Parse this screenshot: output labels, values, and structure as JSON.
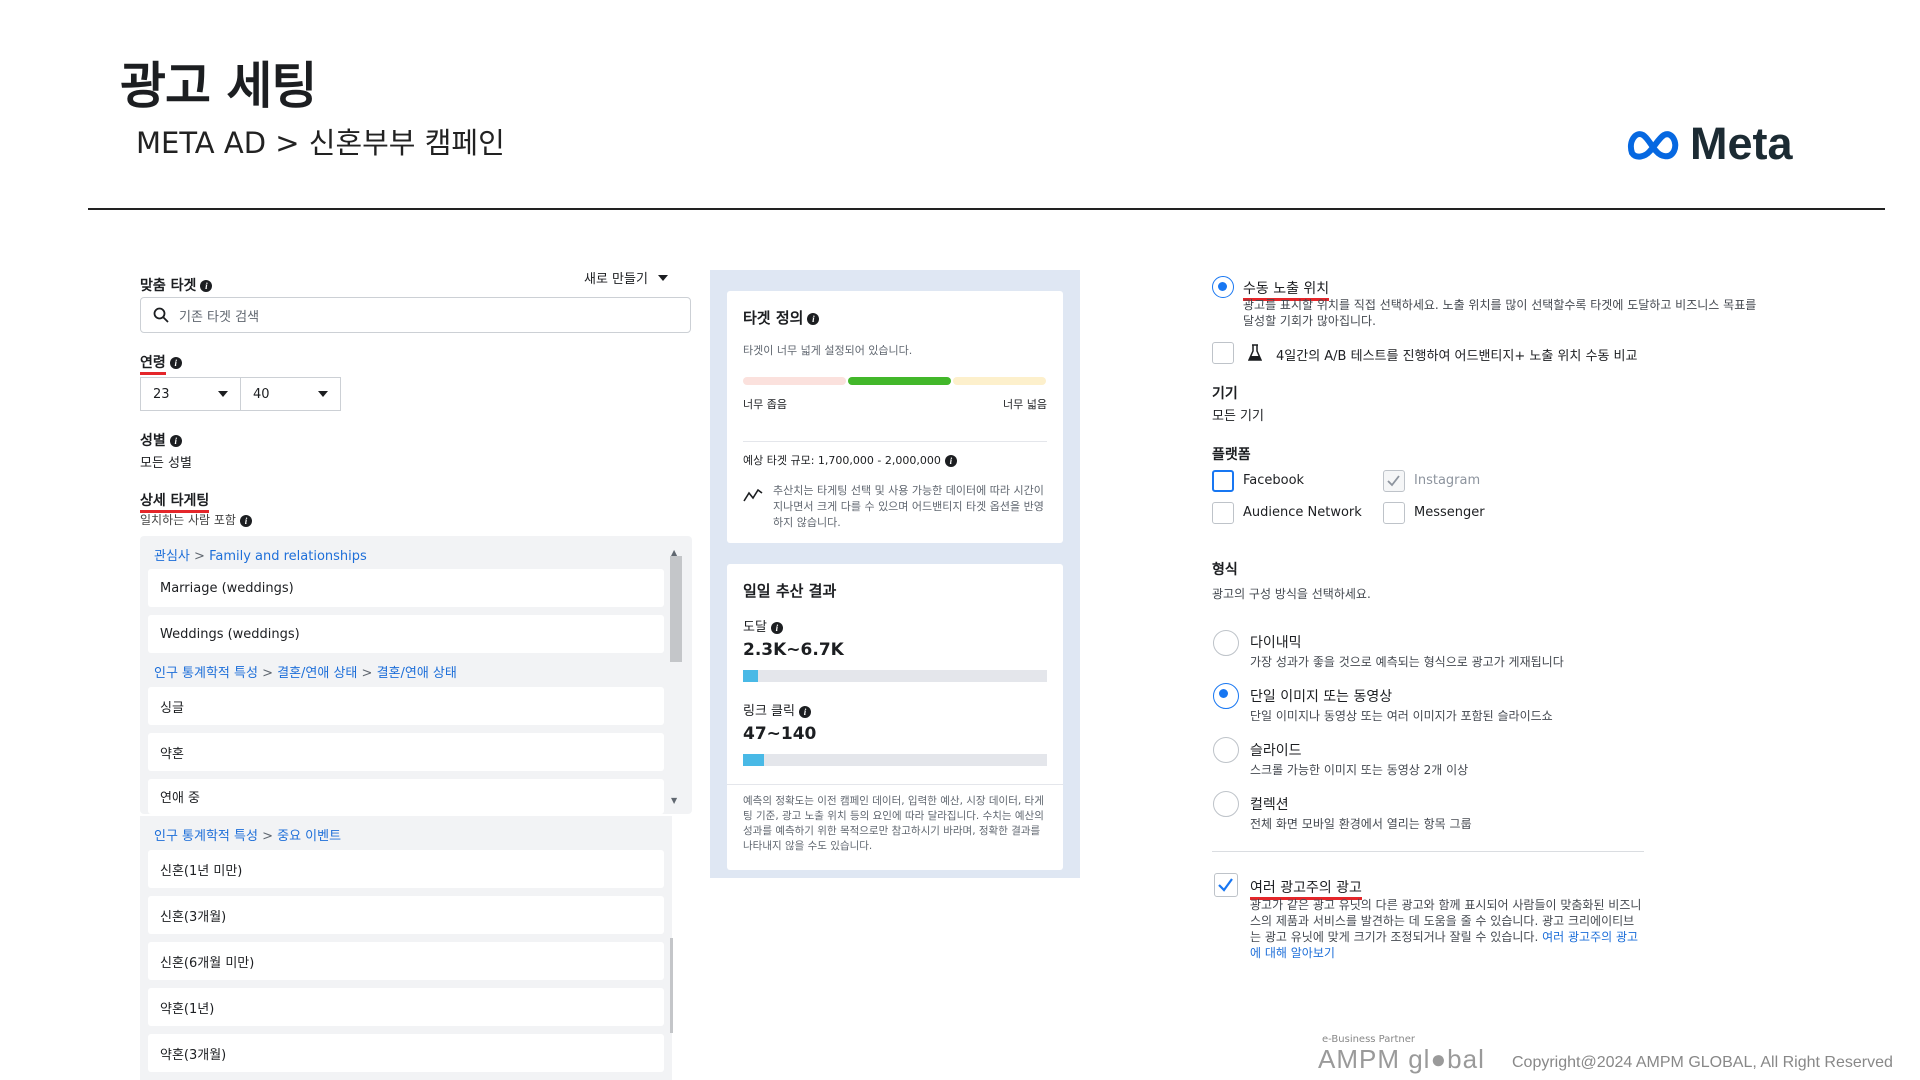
{
  "header": {
    "title": "광고 세팅",
    "subtitle": "META AD > 신혼부부 캠페인",
    "logo_text": "Meta"
  },
  "left": {
    "custom_audience_label": "맞춤 타겟",
    "create_new_label": "새로 만들기",
    "search_placeholder": "기존 타겟 검색",
    "age_label": "연령",
    "age_min": "23",
    "age_max": "40",
    "gender_label": "성별",
    "gender_value": "모든 성별",
    "detailed_label": "상세 타게팅",
    "detailed_sub": "일치하는 사람 포함",
    "group1": {
      "crumb1": "관심사",
      "crumb2": "Family and relationships",
      "items": [
        "Marriage (weddings)",
        "Weddings (weddings)"
      ]
    },
    "group2": {
      "crumb1": "인구 통계학적 특성",
      "crumb2": "결혼/연애 상태",
      "crumb3": "결혼/연애 상태",
      "items": [
        "싱글",
        "약혼",
        "연애 중"
      ]
    },
    "group3": {
      "crumb1": "인구 통계학적 특성",
      "crumb2": "중요 이벤트",
      "items": [
        "신혼(1년 미만)",
        "신혼(3개월)",
        "신혼(6개월 미만)",
        "약혼(1년)",
        "약혼(3개월)"
      ]
    }
  },
  "middle": {
    "def_title": "타겟 정의",
    "def_msg": "타겟이 너무 넓게 설정되어 있습니다.",
    "narrow": "너무 좁음",
    "broad": "너무 넓음",
    "size_label": "예상 타겟 규모: 1,700,000 - 2,000,000",
    "estimate_note": "추산치는 타게팅 선택 및 사용 가능한 데이터에 따라 시간이 지나면서 크게 다를 수 있으며 어드밴티지 타겟 옵션을 반영하지 않습니다.",
    "daily_title": "일일 추산 결과",
    "reach_label": "도달",
    "reach_value": "2.3K~6.7K",
    "reach_fill": 0.05,
    "clicks_label": "링크 클릭",
    "clicks_value": "47~140",
    "clicks_fill": 0.07,
    "accuracy_note": "예측의 정확도는 이전 캠페인 데이터, 입력한 예산, 시장 데이터, 타게팅 기준, 광고 노출 위치 등의 요인에 따라 달라집니다. 수치는 예산의 성과를 예측하기 위한 목적으로만 참고하시기 바라며, 정확한 결과를 나타내지 않을 수도 있습니다."
  },
  "right": {
    "manual_title": "수동 노출 위치",
    "manual_desc": "광고를 표시할 위치를 직접 선택하세요. 노출 위치를 많이 선택할수록 타겟에 도달하고 비즈니스 목표를 달성할 기회가 많아집니다.",
    "ab_test": "4일간의 A/B 테스트를 진행하여 어드밴티지+ 노출 위치 수동 비교",
    "device_label": "기기",
    "device_value": "모든 기기",
    "platform_label": "플랫폼",
    "platforms": [
      "Facebook",
      "Instagram",
      "Audience Network",
      "Messenger"
    ],
    "format_label": "형식",
    "format_desc": "광고의 구성 방식을 선택하세요.",
    "formats": [
      {
        "title": "다이내믹",
        "desc": "가장 성과가 좋을 것으로 예측되는 형식으로 광고가 게재됩니다"
      },
      {
        "title": "단일 이미지 또는 동영상",
        "desc": "단일 이미지나 동영상 또는 여러 이미지가 포함된 슬라이드쇼"
      },
      {
        "title": "슬라이드",
        "desc": "스크롤 가능한 이미지 또는 동영상 2개 이상"
      },
      {
        "title": "컬렉션",
        "desc": "전체 화면 모바일 환경에서 열리는 항목 그룹"
      }
    ],
    "multi_title": "여러 광고주의 광고",
    "multi_desc": "광고가 같은 광고 유닛의 다른 광고와 함께 표시되어 사람들이 맞춤화된 비즈니스의 제품과 서비스를 발견하는 데 도움을 줄 수 있습니다. 광고 크리에이티브는 광고 유닛에 맞게 크기가 조정되거나 잘릴 수 있습니다.",
    "multi_link": "여러 광고주의 광고에 대해 알아보기"
  },
  "footer": {
    "partner_small": "e-Business Partner",
    "partner_logo": "AMPM gl●bal",
    "copyright": "Copyright@2024 AMPM GLOBAL, All Right Reserved"
  },
  "colors": {
    "accent": "#1877f2",
    "underline": "#e4262a",
    "link": "#1e6fd9",
    "meter": "#49b9e6",
    "good": "#42b72a"
  }
}
